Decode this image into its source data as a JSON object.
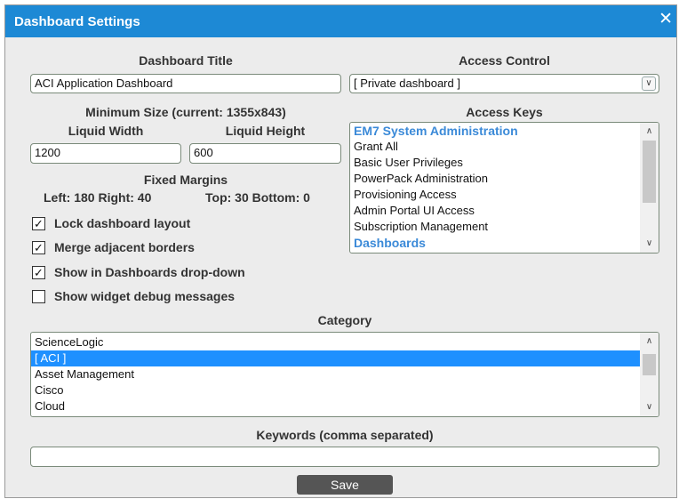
{
  "dialog": {
    "title": "Dashboard Settings",
    "close_glyph": "✕"
  },
  "dashboard_title": {
    "label": "Dashboard Title",
    "value": "ACI Application Dashboard"
  },
  "access_control": {
    "label": "Access Control",
    "selected": "[ Private dashboard ]"
  },
  "min_size": {
    "label": "Minimum Size (current: 1355x843)"
  },
  "liquid_width": {
    "label": "Liquid Width",
    "value": "1200"
  },
  "liquid_height": {
    "label": "Liquid Height",
    "value": "600"
  },
  "fixed_margins": {
    "label": "Fixed Margins",
    "left_right": "Left: 180 Right: 40",
    "top_bottom": "Top: 30 Bottom: 0"
  },
  "access_keys": {
    "label": "Access Keys",
    "items": [
      "EM7 System Administration",
      "Grant All",
      "Basic User Privileges",
      "PowerPack Administration",
      "Provisioning Access",
      "Admin Portal UI Access",
      "Subscription Management",
      "Dashboards"
    ]
  },
  "options": [
    {
      "label": "Lock dashboard layout",
      "checked": true
    },
    {
      "label": "Merge adjacent borders",
      "checked": true
    },
    {
      "label": "Show in Dashboards drop-down",
      "checked": true
    },
    {
      "label": "Show widget debug messages",
      "checked": false
    }
  ],
  "category": {
    "label": "Category",
    "items": [
      "ScienceLogic",
      "[ ACI ]",
      "Asset Management",
      "Cisco",
      "Cloud"
    ],
    "selected_index": 1
  },
  "keywords": {
    "label": "Keywords (comma separated)",
    "value": ""
  },
  "save_label": "Save",
  "colors": {
    "title_bar": "#1d89d5",
    "selection": "#1e90ff",
    "group_heading": "#3b8ad8",
    "save_button": "#555555"
  },
  "icons": {
    "close": "close-icon",
    "select_arrow": "chevron-down-icon",
    "scroll_up": "scroll-up-arrow",
    "scroll_down": "scroll-down-arrow"
  }
}
